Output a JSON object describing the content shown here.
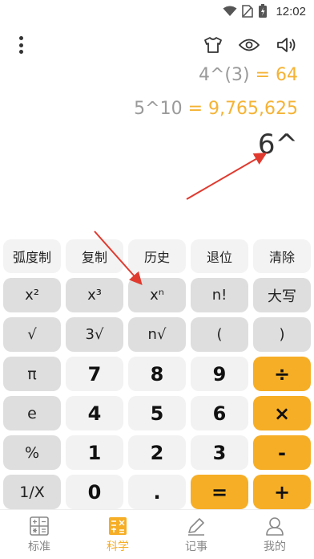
{
  "status": {
    "time": "12:02"
  },
  "toolbar": {
    "icons": [
      "more-vert-icon",
      "shirt-icon",
      "eye-icon",
      "volume-icon"
    ]
  },
  "display": {
    "history": [
      {
        "expression": "4^(3)",
        "equals": "=",
        "result": "64"
      },
      {
        "expression": "5^10",
        "equals": "=",
        "result": "9,765,625"
      }
    ],
    "current": "6^"
  },
  "keypad": {
    "top_row": [
      "弧度制",
      "复制",
      "历史",
      "退位",
      "清除"
    ],
    "rows": [
      [
        "x²",
        "x³",
        "xⁿ",
        "n!",
        "大写"
      ],
      [
        "√",
        "3√",
        "n√",
        "(",
        ")"
      ],
      [
        "π",
        "7",
        "8",
        "9",
        "÷"
      ],
      [
        "e",
        "4",
        "5",
        "6",
        "×"
      ],
      [
        "%",
        "1",
        "2",
        "3",
        "-"
      ],
      [
        "1/X",
        "0",
        ".",
        "=",
        "+"
      ]
    ]
  },
  "nav": {
    "items": [
      {
        "label": "标准",
        "icon": "calculator-grid-icon",
        "active": false
      },
      {
        "label": "科学",
        "icon": "scientific-icon",
        "active": true
      },
      {
        "label": "记事",
        "icon": "pencil-icon",
        "active": false
      },
      {
        "label": "我的",
        "icon": "user-icon",
        "active": false
      }
    ]
  },
  "colors": {
    "accent": "#f6ae26",
    "result": "#f5b335",
    "expression": "#9a9a9a",
    "annotation_arrow": "#e03a2f"
  }
}
